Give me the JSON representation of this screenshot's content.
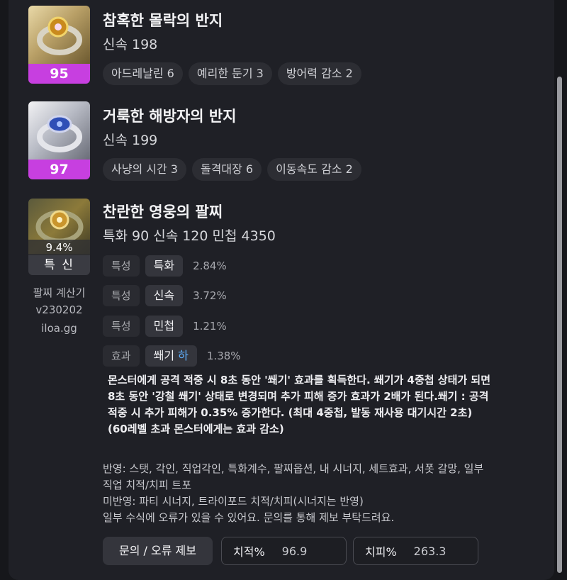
{
  "items": [
    {
      "name": "참혹한 몰락의 반지",
      "stat": "신속 198",
      "level": "95",
      "effects": [
        "아드레날린 6",
        "예리한 둔기 3",
        "방어력 감소 2"
      ]
    },
    {
      "name": "거룩한 해방자의 반지",
      "stat": "신속 199",
      "level": "97",
      "effects": [
        "사냥의 시간 3",
        "돌격대장 6",
        "이동속도 감소 2"
      ]
    }
  ],
  "bracelet": {
    "name": "찬란한 영웅의 팔찌",
    "stats": "특화 90  신속 120  민첩 4350",
    "percent": "9.4%",
    "tier": "특 신",
    "calculator": [
      "팔찌 계산기",
      "v230202",
      "iloa.gg"
    ],
    "options": [
      {
        "type": "특성",
        "name": "특화",
        "value": "2.84%"
      },
      {
        "type": "특성",
        "name": "신속",
        "value": "3.72%"
      },
      {
        "type": "특성",
        "name": "민첩",
        "value": "1.21%"
      },
      {
        "type": "효과",
        "name": "쐐기",
        "grade": "하",
        "value": "1.38%"
      }
    ],
    "description": [
      "몬스터에게 공격 적중 시 8초 동안 '쐐기' 효과를 획득한다. 쐐기가 4중첩 상태가 되면",
      "8초 동안 '강철 쐐기' 상태로 변경되며 추가 피해 증가 효과가 2배가 된다.쐐기 : 공격",
      "적중 시 추가 피해가 0.35% 증가한다. (최대 4중첩, 발동 재사용 대기시간 2초)",
      "(60레벨 초과 몬스터에게는 효과 감소)"
    ]
  },
  "notes": [
    "반영: 스탯, 각인, 직업각인, 특화계수, 팔찌옵션, 내 시너지, 세트효과, 서폿 갈망, 일부",
    "직업 치적/치피 트포",
    "미반영: 파티 시너지, 트라이포드 치적/치피(시너지는 반영)",
    "일부 수식에 오류가 있을 수 있어요. 문의를 통해 제보 부탁드려요."
  ],
  "footer": {
    "report_button": "문의 / 오류 제보",
    "crit_rate_label": "치적%",
    "crit_rate_value": "96.9",
    "crit_dmg_label": "치피%",
    "crit_dmg_value": "263.3"
  },
  "colors": {
    "level_badge": "#c73fe0",
    "grade_low": "#5fb0ff"
  }
}
